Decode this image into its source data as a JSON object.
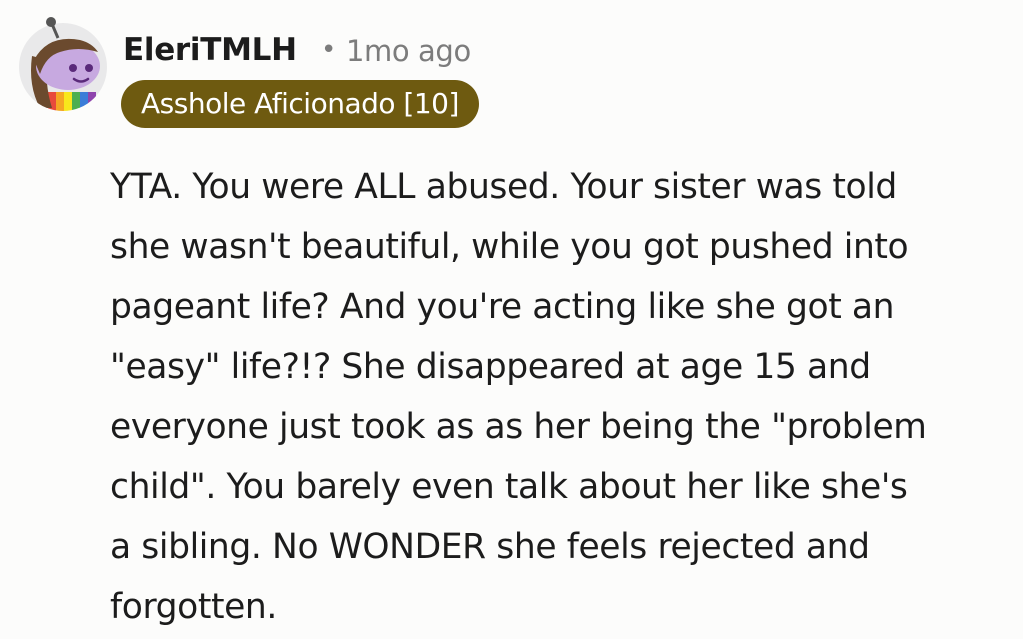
{
  "comment": {
    "author": "EleriTMLH",
    "separator": "•",
    "timestamp": "1mo ago",
    "flair": "Asshole Aficionado [10]",
    "body_lines": [
      "YTA. You were ALL abused. Your sister was told",
      "she wasn't beautiful, while you got pushed into",
      "pageant life? And you're acting like she got an",
      "\"easy\" life?!? She disappeared at age 15 and",
      "everyone just took as as her being the \"problem",
      "child\". You barely even talk about her like she's",
      "a sibling. No WONDER she feels rejected and",
      "forgotten."
    ]
  },
  "icons": {
    "avatar": "snoo-avatar-icon"
  },
  "colors": {
    "background": "#fcfcfb",
    "flair_background": "#6e5a10",
    "flair_text": "#ffffff",
    "meta_text": "#7c7c7c",
    "body_text": "#1c1c1c"
  }
}
